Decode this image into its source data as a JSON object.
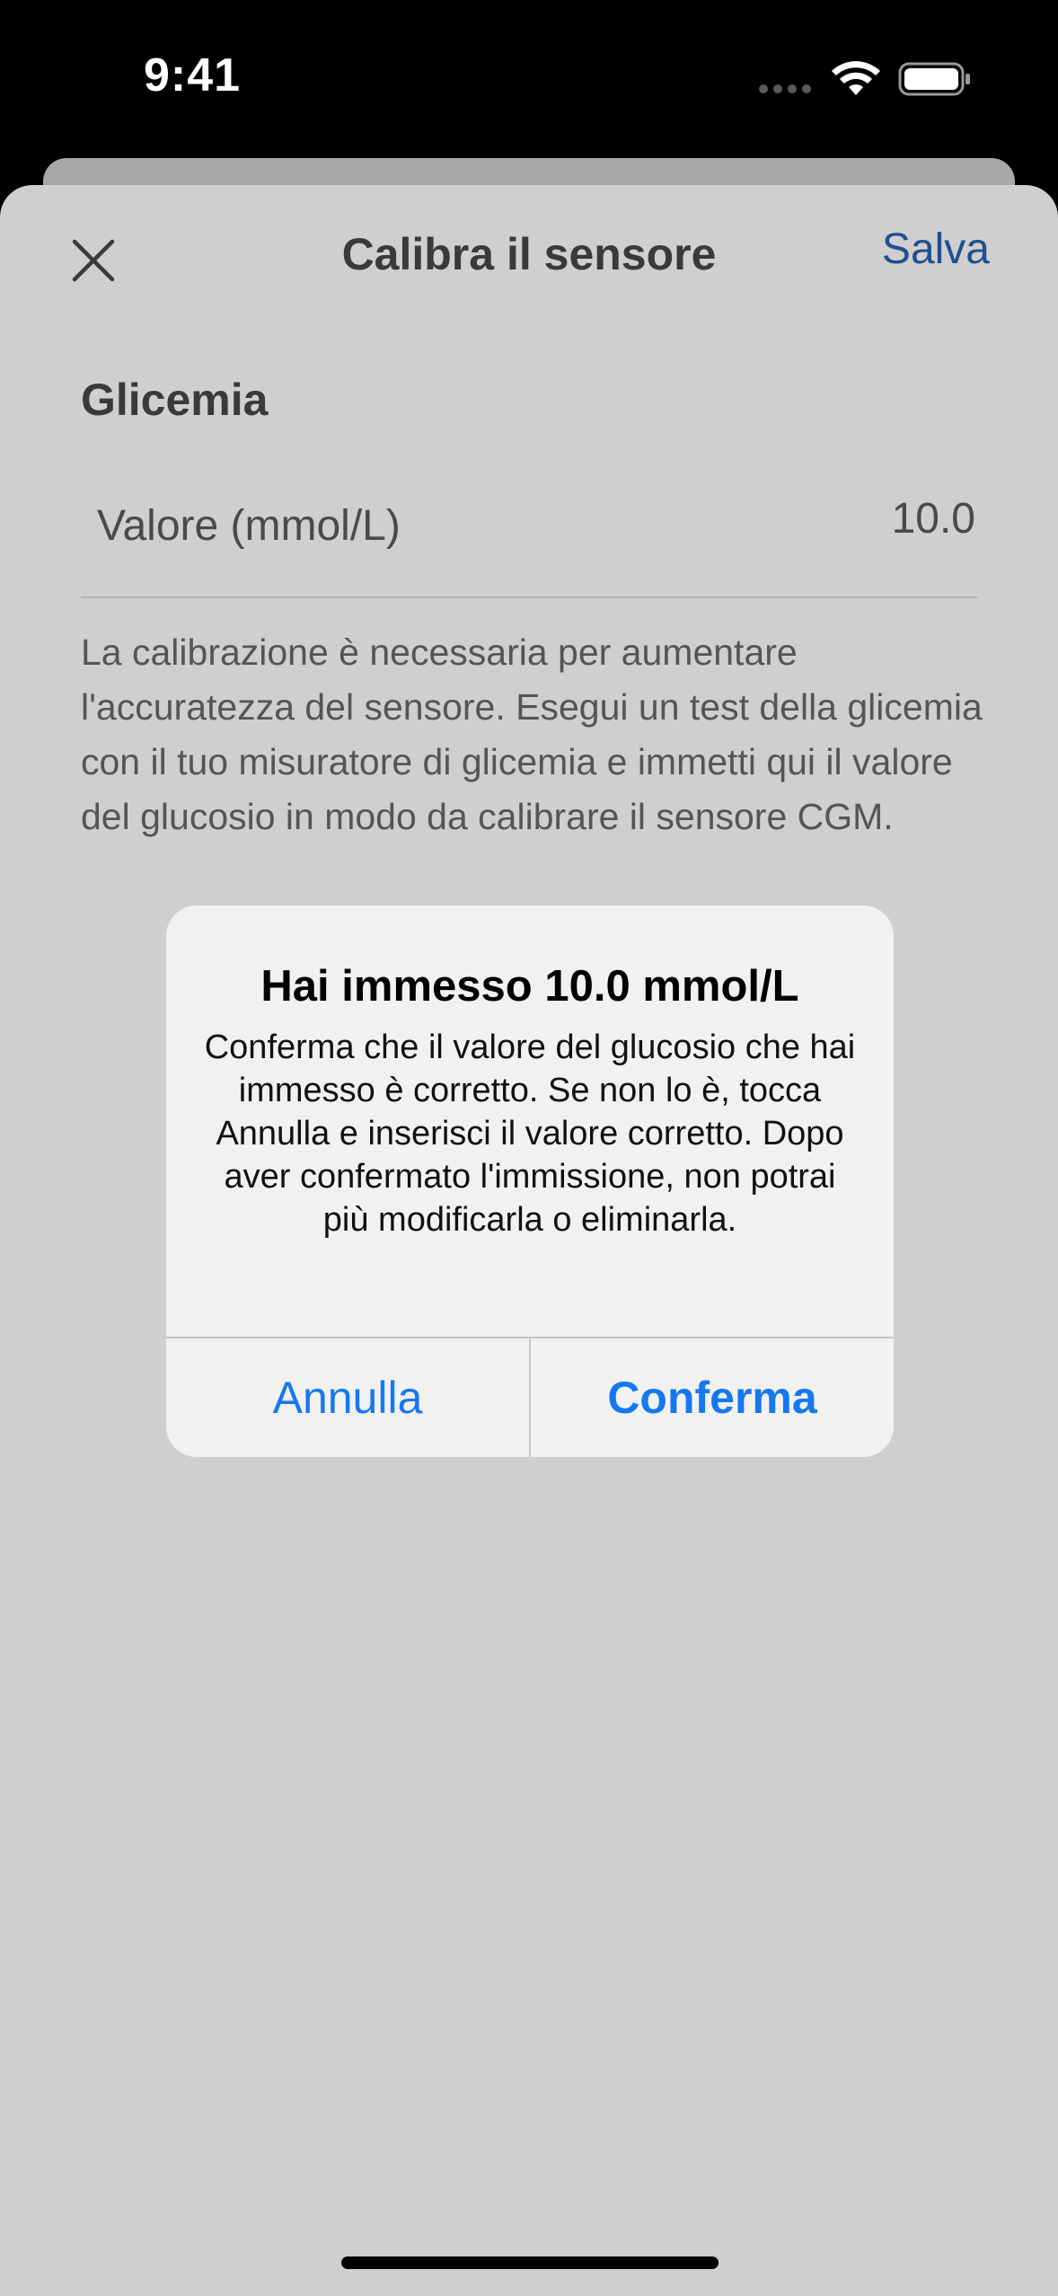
{
  "status_bar": {
    "time": "9:41",
    "icons": [
      "signal-dots-icon",
      "wifi-icon",
      "battery-icon"
    ]
  },
  "nav": {
    "title": "Calibra il sensore",
    "save_label": "Salva",
    "close_icon": "close-icon"
  },
  "form": {
    "section_title": "Glicemia",
    "value_label": "Valore (mmol/L)",
    "value": "10.0",
    "description": "La calibrazione è necessaria per aumentare l'accuratezza del sensore. Esegui un test della glicemia con il tuo misuratore di glicemia e immetti qui il valore del glucosio in modo da calibrare il sensore CGM."
  },
  "alert": {
    "title": "Hai immesso 10.0 mmol/L",
    "message": "Conferma che il valore del glucosio che hai immesso è corretto. Se non lo è, tocca Annulla e inserisci il valore corretto. Dopo aver confermato l'immissione, non potrai più modificarla o eliminarla.",
    "cancel_label": "Annulla",
    "confirm_label": "Conferma"
  },
  "colors": {
    "accent": "#1678f0",
    "save_link": "#1f4f8f",
    "sheet_background": "#cfcfcf",
    "alert_background": "#f1f1f0"
  }
}
